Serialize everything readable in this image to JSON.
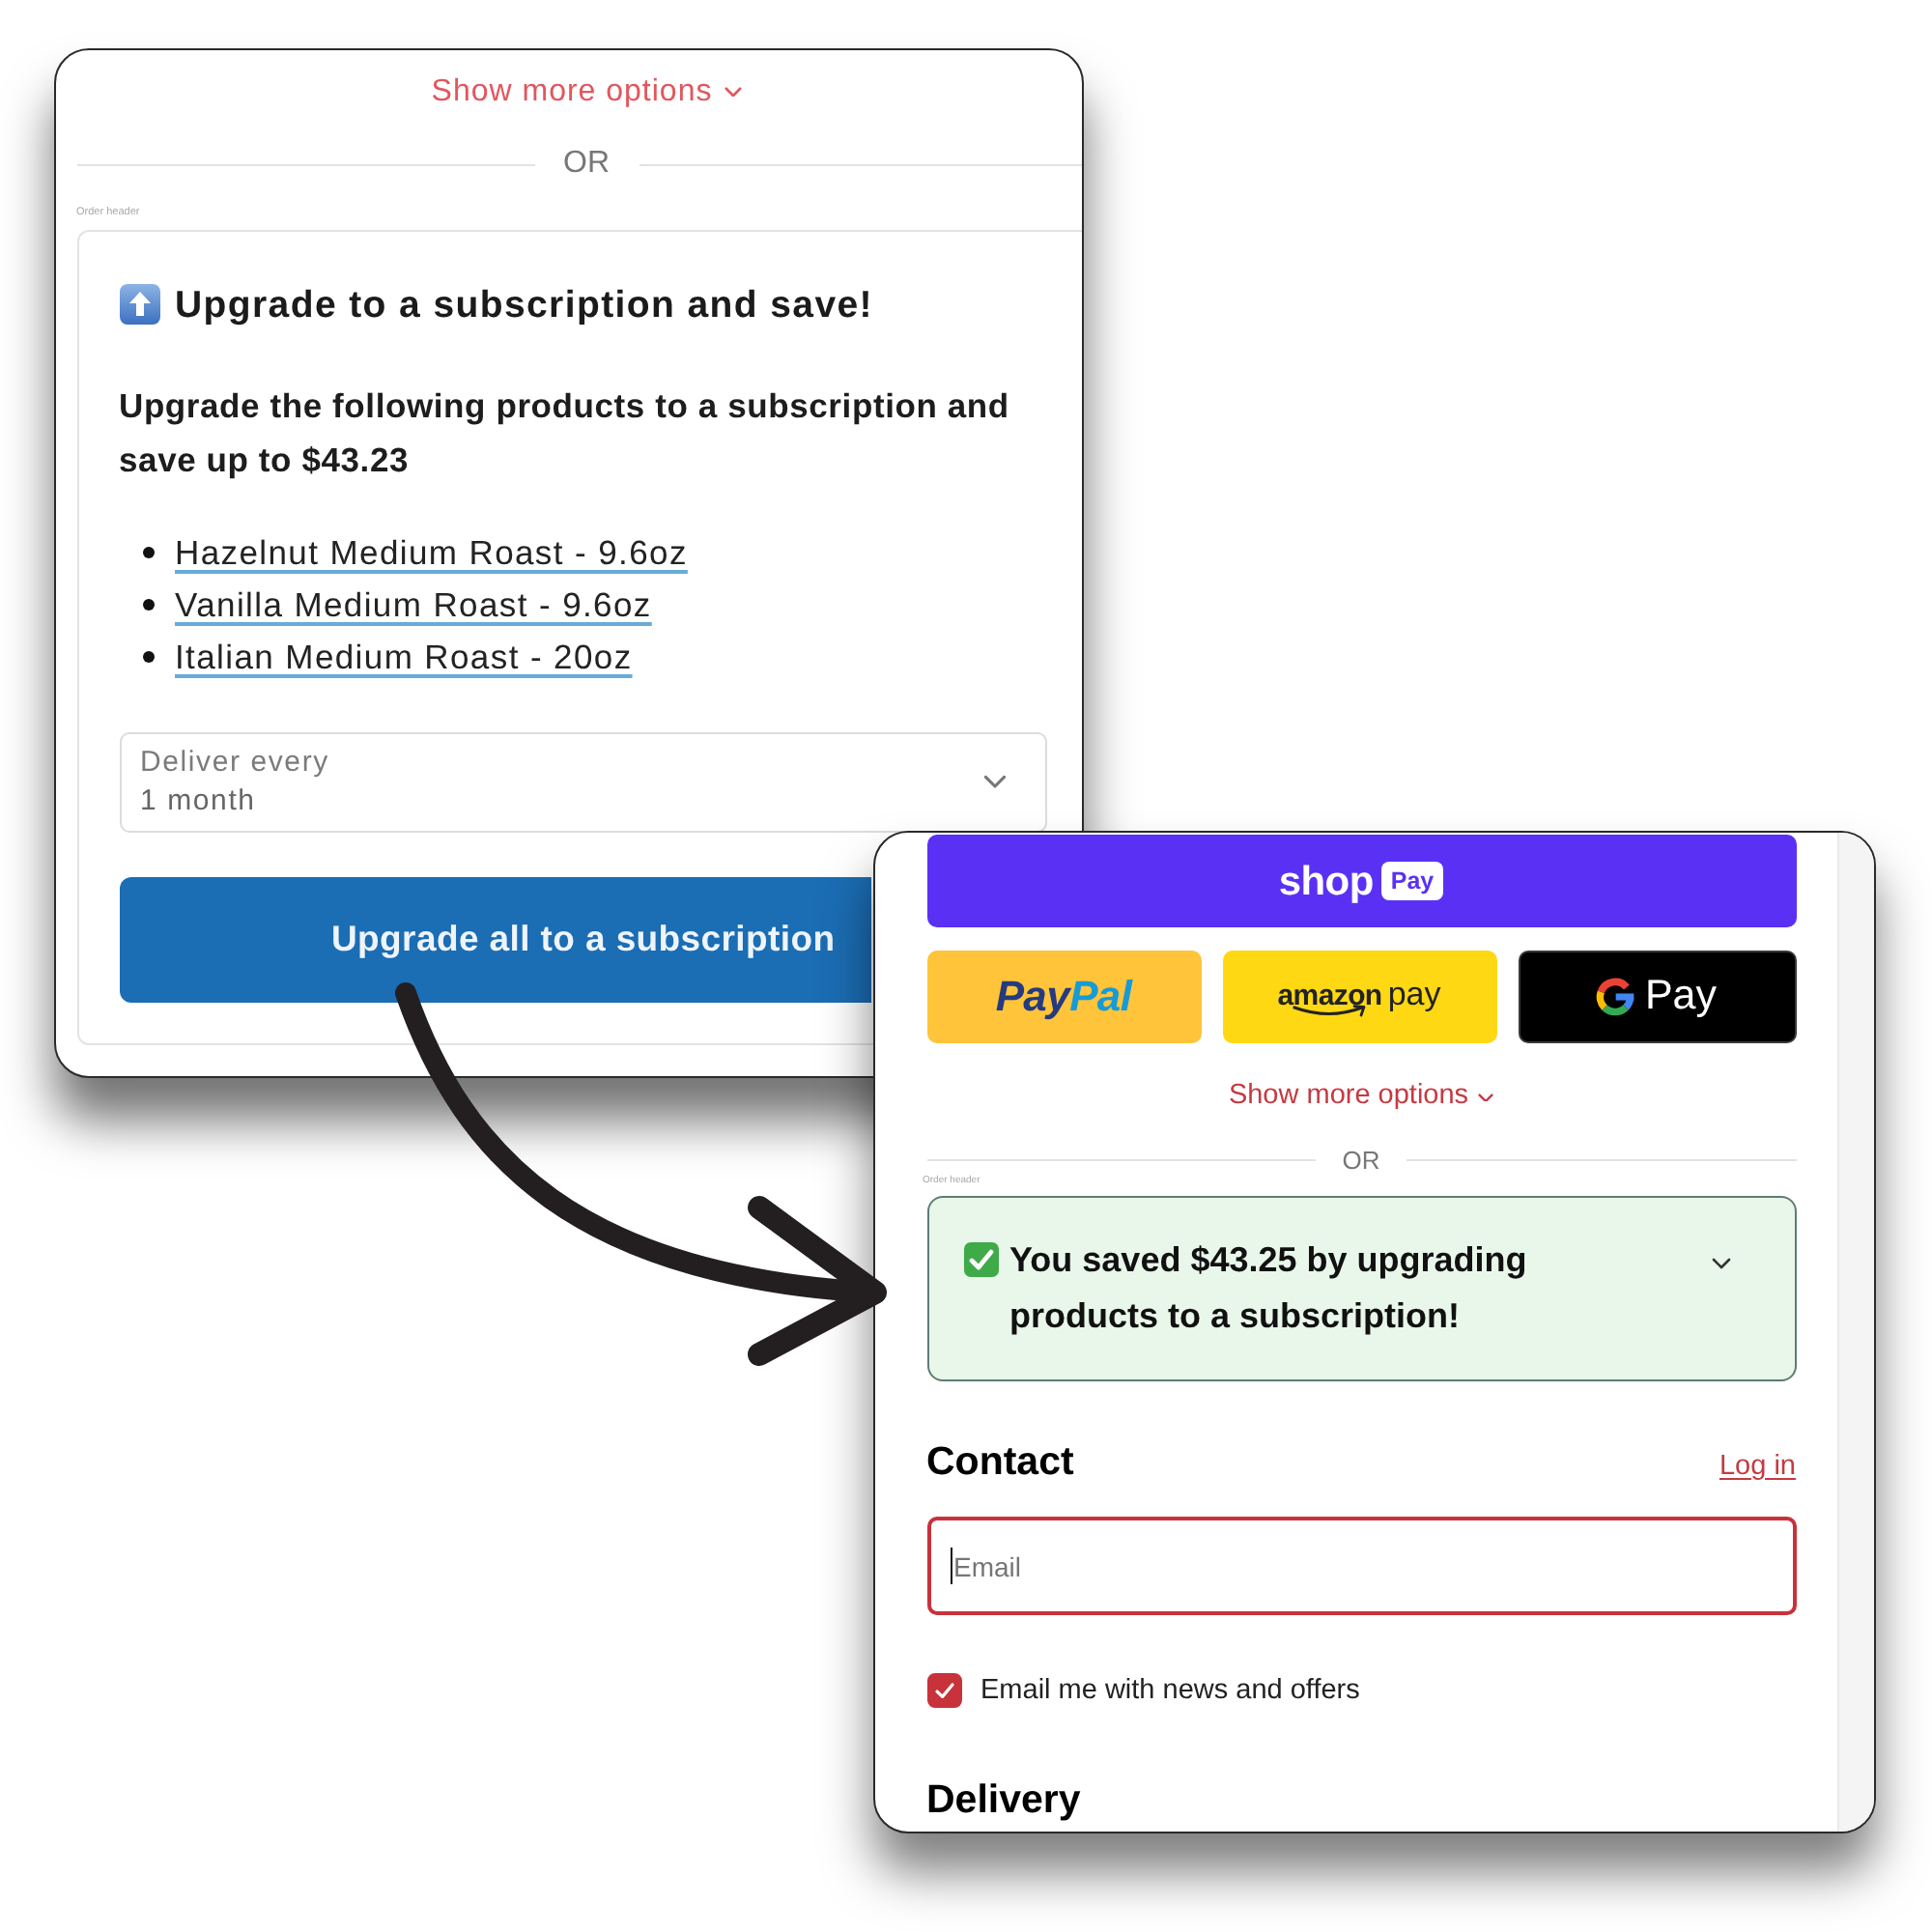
{
  "left_panel": {
    "show_more_link": "Show more options",
    "divider_label": "OR",
    "section_label": "Order header",
    "upgrade_offer": {
      "title": "Upgrade to a subscription and save!",
      "description": "Upgrade the following products to a subscription and save up to $43.23",
      "products": [
        "Hazelnut Medium Roast - 9.6oz",
        "Vanilla Medium Roast - 9.6oz",
        "Italian Medium Roast - 20oz"
      ],
      "frequency_select": {
        "label": "Deliver every",
        "value": "1 month"
      },
      "button": "Upgrade all to a subscription"
    }
  },
  "right_panel": {
    "shop_pay_button": {
      "wordmark": "shop",
      "badge": "Pay"
    },
    "wallet_buttons": [
      {
        "kind": "paypal",
        "parts": [
          "Pay",
          "Pal"
        ]
      },
      {
        "kind": "amazon_pay",
        "parts": [
          "amazon",
          "pay"
        ]
      },
      {
        "kind": "google_pay",
        "parts": [
          "Pay"
        ]
      }
    ],
    "show_more_link": "Show more options",
    "divider_label": "OR",
    "section_label": "Order header",
    "savings_banner": {
      "text": "You saved $43.25 by upgrading products to a subscription!"
    },
    "contact": {
      "heading": "Contact",
      "login_link": "Log in",
      "email_field": {
        "placeholder": "Email",
        "focused": true
      },
      "newsletter_checkbox": {
        "label": "Email me with news and offers",
        "checked": true
      }
    },
    "delivery_heading": "Delivery"
  }
}
